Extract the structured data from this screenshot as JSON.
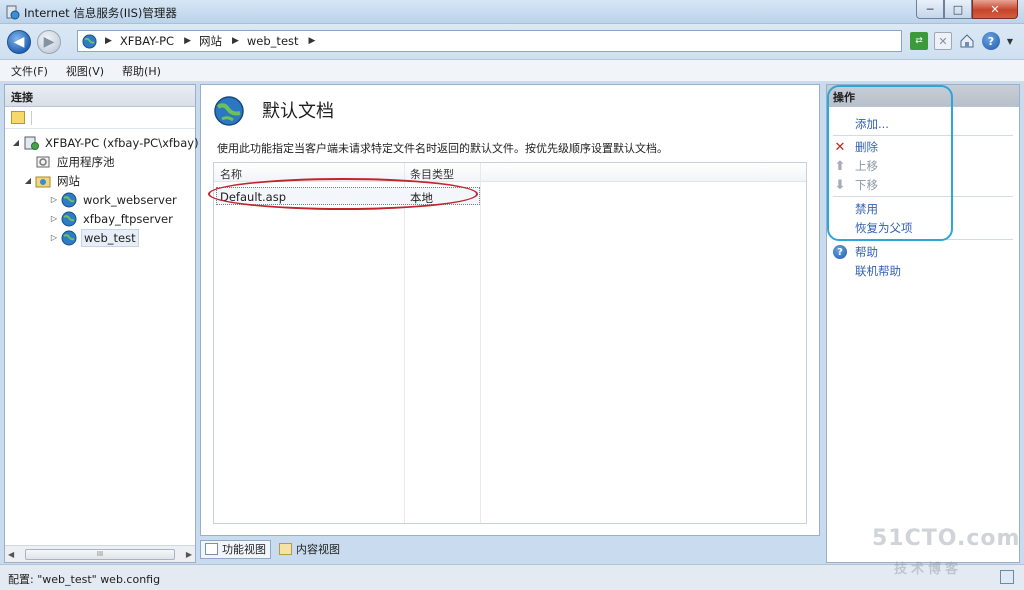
{
  "window": {
    "title": "Internet 信息服务(IIS)管理器",
    "buttons": {
      "minimize": "─",
      "maximize": "□",
      "close": "✕"
    }
  },
  "address": {
    "back": "◀",
    "forward": "▶",
    "path": [
      "XFBAY-PC",
      "网站",
      "web_test"
    ],
    "separator": "▶"
  },
  "menu": [
    "文件(F)",
    "视图(V)",
    "帮助(H)"
  ],
  "connections": {
    "header": "连接",
    "tree": [
      {
        "label": "XFBAY-PC (xfbay-PC\\xfbay)",
        "level": 0,
        "expander": "◢",
        "icon": "server-icon"
      },
      {
        "label": "应用程序池",
        "level": 1,
        "expander": "",
        "icon": "app-pool-icon"
      },
      {
        "label": "网站",
        "level": 1,
        "expander": "◢",
        "icon": "sites-folder-icon"
      },
      {
        "label": "work_webserver",
        "level": 2,
        "expander": "▷",
        "icon": "globe-icon"
      },
      {
        "label": "xfbay_ftpserver",
        "level": 2,
        "expander": "▷",
        "icon": "globe-icon"
      },
      {
        "label": "web_test",
        "level": 2,
        "expander": "▷",
        "icon": "globe-icon",
        "selected": true
      }
    ],
    "scroll": {
      "left": "◀",
      "right": "▶",
      "grip": "III"
    }
  },
  "main": {
    "title": "默认文档",
    "description": "使用此功能指定当客户端未请求特定文件名时返回的默认文件。按优先级顺序设置默认文档。",
    "columns": [
      "名称",
      "条目类型"
    ],
    "rows": [
      {
        "name": "Default.asp",
        "type": "本地"
      }
    ]
  },
  "views": [
    "功能视图",
    "内容视图"
  ],
  "actions": {
    "header": "操作",
    "items": [
      {
        "label": "添加...",
        "icon": "",
        "state": "link"
      },
      {
        "label": "删除",
        "icon": "✕",
        "state": "link"
      },
      {
        "label": "上移",
        "icon": "⬆",
        "state": "disabled"
      },
      {
        "label": "下移",
        "icon": "⬇",
        "state": "disabled"
      },
      {
        "label": "禁用",
        "icon": "",
        "state": "link"
      },
      {
        "label": "恢复为父项",
        "icon": "",
        "state": "link"
      },
      {
        "label": "帮助",
        "icon": "?",
        "state": "link"
      },
      {
        "label": "联机帮助",
        "icon": "",
        "state": "link"
      }
    ]
  },
  "status": {
    "text": "配置: \"web_test\"  web.config"
  },
  "watermark": {
    "line1": "51CTO.com",
    "line2": "技术博客"
  },
  "colors": {
    "link": "#3161b4",
    "highlight_red": "#c0242c",
    "highlight_blue": "#2da6d8",
    "delete_red": "#c8261c"
  }
}
